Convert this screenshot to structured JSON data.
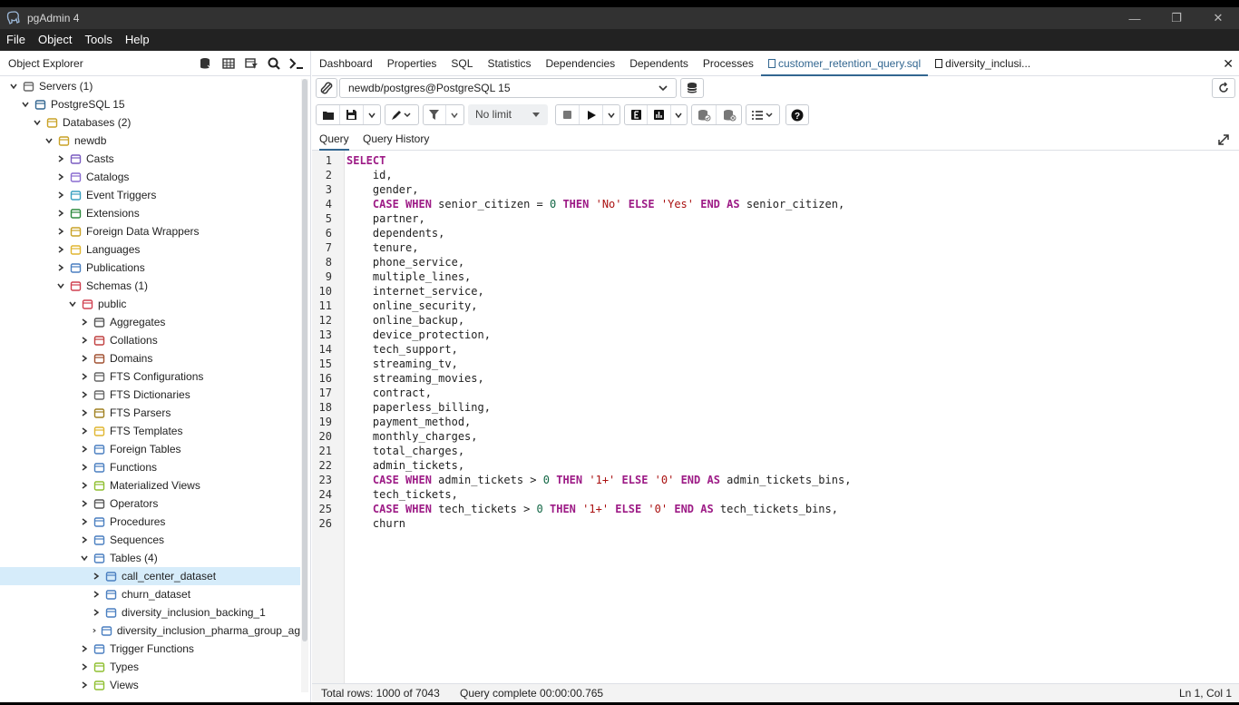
{
  "window": {
    "title": "pgAdmin 4",
    "min": "—",
    "restore": "❐",
    "close": "✕"
  },
  "menu": [
    "File",
    "Object",
    "Tools",
    "Help"
  ],
  "explorer": {
    "title": "Object Explorer",
    "tree": [
      {
        "label": "Servers (1)",
        "indent": 0,
        "chev": "down",
        "icon": "servers-icon",
        "color": "#666"
      },
      {
        "label": "PostgreSQL 15",
        "indent": 1,
        "chev": "down",
        "icon": "postgres-elephant-icon",
        "color": "#336791"
      },
      {
        "label": "Databases (2)",
        "indent": 2,
        "chev": "down",
        "icon": "databases-icon",
        "color": "#c9a227"
      },
      {
        "label": "newdb",
        "indent": 3,
        "chev": "down",
        "icon": "database-icon",
        "color": "#c9a227"
      },
      {
        "label": "Casts",
        "indent": 4,
        "chev": "right",
        "icon": "casts-icon",
        "color": "#7a5cc0"
      },
      {
        "label": "Catalogs",
        "indent": 4,
        "chev": "right",
        "icon": "catalogs-icon",
        "color": "#8a6cd0"
      },
      {
        "label": "Event Triggers",
        "indent": 4,
        "chev": "right",
        "icon": "event-triggers-icon",
        "color": "#3aa0c0"
      },
      {
        "label": "Extensions",
        "indent": 4,
        "chev": "right",
        "icon": "extensions-icon",
        "color": "#2e8b3e"
      },
      {
        "label": "Foreign Data Wrappers",
        "indent": 4,
        "chev": "right",
        "icon": "fdw-icon",
        "color": "#c9a227"
      },
      {
        "label": "Languages",
        "indent": 4,
        "chev": "right",
        "icon": "languages-icon",
        "color": "#e0b630"
      },
      {
        "label": "Publications",
        "indent": 4,
        "chev": "right",
        "icon": "publications-icon",
        "color": "#4a7fc0"
      },
      {
        "label": "Schemas (1)",
        "indent": 4,
        "chev": "down",
        "icon": "schemas-icon",
        "color": "#d04050"
      },
      {
        "label": "public",
        "indent": 5,
        "chev": "down",
        "icon": "schema-icon",
        "color": "#d04050"
      },
      {
        "label": "Aggregates",
        "indent": 6,
        "chev": "right",
        "icon": "aggregates-icon",
        "color": "#555"
      },
      {
        "label": "Collations",
        "indent": 6,
        "chev": "right",
        "icon": "collations-icon",
        "color": "#c04040"
      },
      {
        "label": "Domains",
        "indent": 6,
        "chev": "right",
        "icon": "domains-icon",
        "color": "#a05030"
      },
      {
        "label": "FTS Configurations",
        "indent": 6,
        "chev": "right",
        "icon": "fts-configurations-icon",
        "color": "#666"
      },
      {
        "label": "FTS Dictionaries",
        "indent": 6,
        "chev": "right",
        "icon": "fts-dictionaries-icon",
        "color": "#666"
      },
      {
        "label": "FTS Parsers",
        "indent": 6,
        "chev": "right",
        "icon": "fts-parsers-icon",
        "color": "#a08020"
      },
      {
        "label": "FTS Templates",
        "indent": 6,
        "chev": "right",
        "icon": "fts-templates-icon",
        "color": "#e0b630"
      },
      {
        "label": "Foreign Tables",
        "indent": 6,
        "chev": "right",
        "icon": "foreign-tables-icon",
        "color": "#4a7fc0"
      },
      {
        "label": "Functions",
        "indent": 6,
        "chev": "right",
        "icon": "functions-icon",
        "color": "#4a7fc0"
      },
      {
        "label": "Materialized Views",
        "indent": 6,
        "chev": "right",
        "icon": "materialized-views-icon",
        "color": "#8fbf30"
      },
      {
        "label": "Operators",
        "indent": 6,
        "chev": "right",
        "icon": "operators-icon",
        "color": "#555"
      },
      {
        "label": "Procedures",
        "indent": 6,
        "chev": "right",
        "icon": "procedures-icon",
        "color": "#4a7fc0"
      },
      {
        "label": "Sequences",
        "indent": 6,
        "chev": "right",
        "icon": "sequences-icon",
        "color": "#4a7fc0"
      },
      {
        "label": "Tables (4)",
        "indent": 6,
        "chev": "down",
        "icon": "tables-icon",
        "color": "#4a7fc0"
      },
      {
        "label": "call_center_dataset",
        "indent": 7,
        "chev": "right",
        "icon": "table-icon",
        "color": "#4a7fc0",
        "selected": true
      },
      {
        "label": "churn_dataset",
        "indent": 7,
        "chev": "right",
        "icon": "table-icon",
        "color": "#4a7fc0"
      },
      {
        "label": "diversity_inclusion_backing_1",
        "indent": 7,
        "chev": "right",
        "icon": "table-icon",
        "color": "#4a7fc0"
      },
      {
        "label": "diversity_inclusion_pharma_group_ag",
        "indent": 7,
        "chev": "right",
        "icon": "table-icon",
        "color": "#4a7fc0"
      },
      {
        "label": "Trigger Functions",
        "indent": 6,
        "chev": "right",
        "icon": "trigger-functions-icon",
        "color": "#4a7fc0"
      },
      {
        "label": "Types",
        "indent": 6,
        "chev": "right",
        "icon": "types-icon",
        "color": "#8fbf30"
      },
      {
        "label": "Views",
        "indent": 6,
        "chev": "right",
        "icon": "views-icon",
        "color": "#8fbf30"
      }
    ]
  },
  "tabs": [
    {
      "label": "Dashboard"
    },
    {
      "label": "Properties"
    },
    {
      "label": "SQL"
    },
    {
      "label": "Statistics"
    },
    {
      "label": "Dependencies"
    },
    {
      "label": "Dependents"
    },
    {
      "label": "Processes"
    },
    {
      "label": "customer_retention_query.sql",
      "active": true,
      "doc": true
    },
    {
      "label": "diversity_inclusi...",
      "doc": true
    }
  ],
  "connection": {
    "value": "newdb/postgres@PostgreSQL 15"
  },
  "toolbar": {
    "limit": "No limit"
  },
  "subtabs": {
    "query": "Query",
    "history": "Query History"
  },
  "editor": {
    "lines": [
      [
        [
          "kw",
          "SELECT"
        ]
      ],
      [
        [
          "t",
          "    id,"
        ]
      ],
      [
        [
          "t",
          "    gender,"
        ]
      ],
      [
        [
          "t",
          "    "
        ],
        [
          "kw",
          "CASE WHEN"
        ],
        [
          "t",
          " senior_citizen = "
        ],
        [
          "num",
          "0"
        ],
        [
          "t",
          " "
        ],
        [
          "kw",
          "THEN"
        ],
        [
          "t",
          " "
        ],
        [
          "str",
          "'No'"
        ],
        [
          "t",
          " "
        ],
        [
          "kw",
          "ELSE"
        ],
        [
          "t",
          " "
        ],
        [
          "str",
          "'Yes'"
        ],
        [
          "t",
          " "
        ],
        [
          "kw",
          "END AS"
        ],
        [
          "t",
          " senior_citizen,"
        ]
      ],
      [
        [
          "t",
          "    partner,"
        ]
      ],
      [
        [
          "t",
          "    dependents,"
        ]
      ],
      [
        [
          "t",
          "    tenure,"
        ]
      ],
      [
        [
          "t",
          "    phone_service,"
        ]
      ],
      [
        [
          "t",
          "    multiple_lines,"
        ]
      ],
      [
        [
          "t",
          "    internet_service,"
        ]
      ],
      [
        [
          "t",
          "    online_security,"
        ]
      ],
      [
        [
          "t",
          "    online_backup,"
        ]
      ],
      [
        [
          "t",
          "    device_protection,"
        ]
      ],
      [
        [
          "t",
          "    tech_support,"
        ]
      ],
      [
        [
          "t",
          "    streaming_tv,"
        ]
      ],
      [
        [
          "t",
          "    streaming_movies,"
        ]
      ],
      [
        [
          "t",
          "    contract,"
        ]
      ],
      [
        [
          "t",
          "    paperless_billing,"
        ]
      ],
      [
        [
          "t",
          "    payment_method,"
        ]
      ],
      [
        [
          "t",
          "    monthly_charges,"
        ]
      ],
      [
        [
          "t",
          "    total_charges,"
        ]
      ],
      [
        [
          "t",
          "    admin_tickets,"
        ]
      ],
      [
        [
          "t",
          "    "
        ],
        [
          "kw",
          "CASE WHEN"
        ],
        [
          "t",
          " admin_tickets > "
        ],
        [
          "num",
          "0"
        ],
        [
          "t",
          " "
        ],
        [
          "kw",
          "THEN"
        ],
        [
          "t",
          " "
        ],
        [
          "str",
          "'1+'"
        ],
        [
          "t",
          " "
        ],
        [
          "kw",
          "ELSE"
        ],
        [
          "t",
          " "
        ],
        [
          "str",
          "'0'"
        ],
        [
          "t",
          " "
        ],
        [
          "kw",
          "END AS"
        ],
        [
          "t",
          " admin_tickets_bins,"
        ]
      ],
      [
        [
          "t",
          "    tech_tickets,"
        ]
      ],
      [
        [
          "t",
          "    "
        ],
        [
          "kw",
          "CASE WHEN"
        ],
        [
          "t",
          " tech_tickets > "
        ],
        [
          "num",
          "0"
        ],
        [
          "t",
          " "
        ],
        [
          "kw",
          "THEN"
        ],
        [
          "t",
          " "
        ],
        [
          "str",
          "'1+'"
        ],
        [
          "t",
          " "
        ],
        [
          "kw",
          "ELSE"
        ],
        [
          "t",
          " "
        ],
        [
          "str",
          "'0'"
        ],
        [
          "t",
          " "
        ],
        [
          "kw",
          "END AS"
        ],
        [
          "t",
          " tech_tickets_bins,"
        ]
      ],
      [
        [
          "t",
          "    churn"
        ]
      ]
    ]
  },
  "status": {
    "total_rows": "Total rows: 1000 of 7043",
    "query_complete": "Query complete 00:00:00.765",
    "cursor": "Ln 1, Col 1"
  }
}
